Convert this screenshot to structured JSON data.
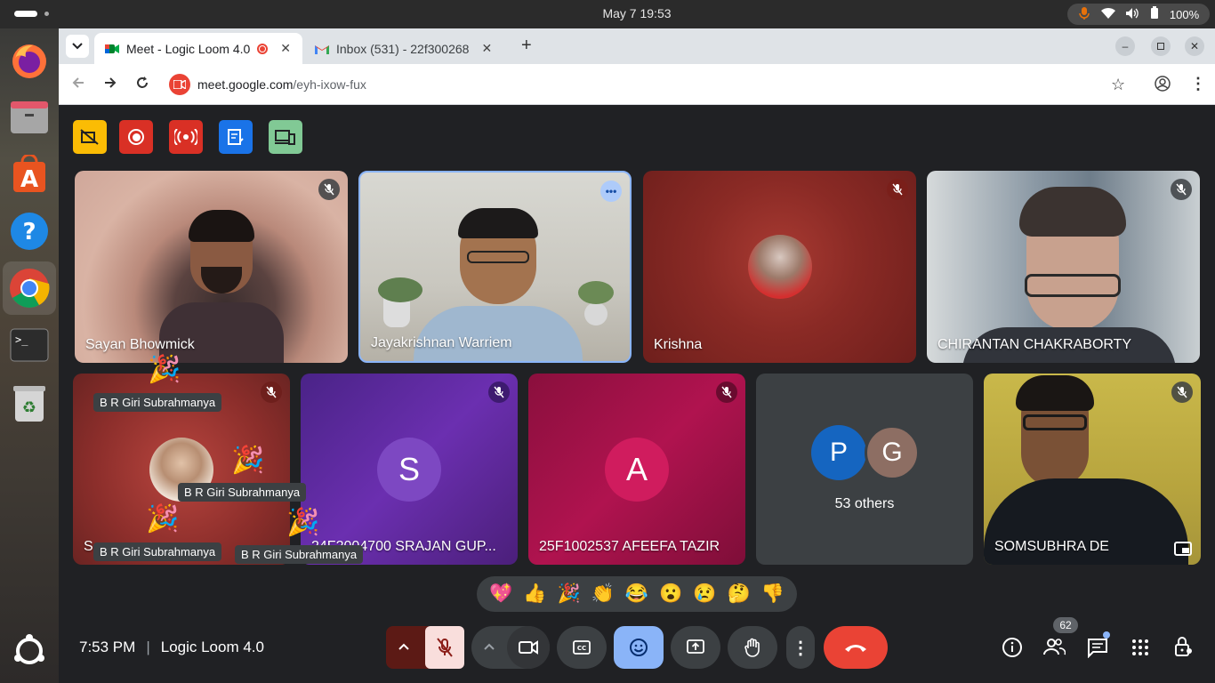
{
  "topbar": {
    "clock": "May 7  19:53",
    "battery": "100%"
  },
  "browser": {
    "tabs": [
      {
        "title": "Meet - Logic Loom 4.0"
      },
      {
        "title": "Inbox (531) - 22f300268"
      }
    ],
    "url_host": "meet.google.com",
    "url_path": "/eyh-ixow-fux"
  },
  "meeting": {
    "time": "7:53 PM",
    "title": "Logic Loom 4.0",
    "participant_count": "62",
    "others_label": "53 others",
    "tiles": [
      {
        "name": "Sayan Bhowmick"
      },
      {
        "name": "Jayakrishnan Warriem"
      },
      {
        "name": "Krishna"
      },
      {
        "name": "CHIRANTAN CHAKRABORTY"
      },
      {
        "name": "S",
        "chip": "B R Giri Subrahmanya"
      },
      {
        "name": "24F2004700 SRAJAN GUP...",
        "initial": "S"
      },
      {
        "name": "25F1002537 AFEEFA TAZIR",
        "initial": "A"
      },
      {
        "name": "SOMSUBHRA DE"
      }
    ],
    "others_initials": [
      "P",
      "G"
    ],
    "reaction_chip_name": "B R Giri Subrahmanya",
    "reactions": [
      "💖",
      "👍",
      "🎉",
      "👏",
      "😂",
      "😮",
      "😢",
      "🤔",
      "👎"
    ],
    "colors": {
      "accent_blue": "#8ab4f8",
      "end_call_red": "#ea4335",
      "control_bg": "#3c4043"
    }
  }
}
